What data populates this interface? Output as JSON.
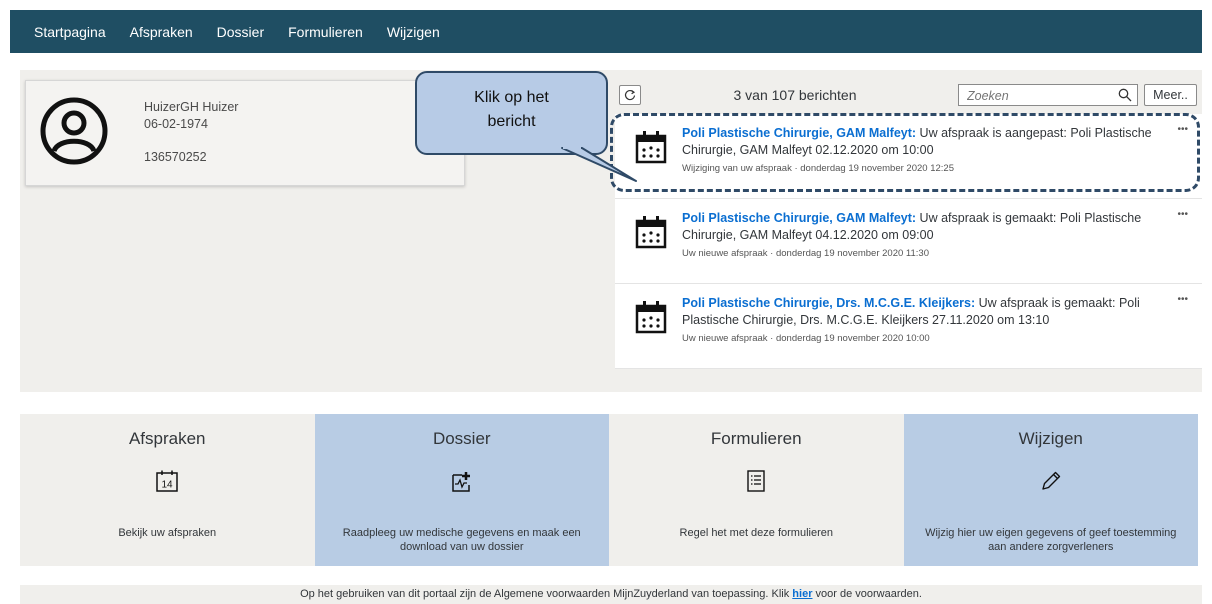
{
  "nav": {
    "items": [
      "Startpagina",
      "Afspraken",
      "Dossier",
      "Formulieren",
      "Wijzigen"
    ]
  },
  "profile": {
    "name": "HuizerGH Huizer",
    "dob": "06-02-1974",
    "id": "136570252"
  },
  "callout": {
    "line1": "Klik op het",
    "line2": "bericht"
  },
  "messages_toolbar": {
    "count_text": "3 van 107 berichten",
    "search_placeholder": "Zoeken",
    "more_label": "Meer.."
  },
  "messages": [
    {
      "title": "Poli Plastische Chirurgie, GAM Malfeyt:",
      "text": " Uw afspraak is aangepast: Poli Plastische Chirurgie, GAM Malfeyt 02.12.2020 om 10:00",
      "meta": "Wijziging van uw afspraak · donderdag 19 november 2020 12:25",
      "more": "•••"
    },
    {
      "title": "Poli Plastische Chirurgie, GAM Malfeyt:",
      "text": " Uw afspraak is gemaakt: Poli Plastische Chirurgie, GAM Malfeyt 04.12.2020 om 09:00",
      "meta": "Uw nieuwe afspraak · donderdag 19 november 2020 11:30",
      "more": "•••"
    },
    {
      "title": "Poli Plastische Chirurgie, Drs. M.C.G.E. Kleijkers:",
      "text": " Uw afspraak is gemaakt: Poli Plastische Chirurgie, Drs. M.C.G.E. Kleijkers 27.11.2020 om 13:10",
      "meta": "Uw nieuwe afspraak · donderdag 19 november 2020 10:00",
      "more": "•••"
    }
  ],
  "tiles": [
    {
      "title": "Afspraken",
      "icon": "calendar-14-icon",
      "icon_text": "14",
      "desc": "Bekijk uw afspraken"
    },
    {
      "title": "Dossier",
      "icon": "medical-record-icon",
      "desc": "Raadpleeg uw medische gegevens en maak een download van uw dossier"
    },
    {
      "title": "Formulieren",
      "icon": "form-list-icon",
      "desc": "Regel het met deze formulieren"
    },
    {
      "title": "Wijzigen",
      "icon": "pencil-icon",
      "desc": "Wijzig hier uw eigen gegevens of geef toestemming aan andere zorgverleners"
    }
  ],
  "footer": {
    "text_before": "Op het gebruiken van dit portaal zijn de Algemene voorwaarden MijnZuyderland van toepassing. Klik ",
    "link": "hier",
    "text_after": " voor de voorwaarden."
  },
  "colors": {
    "topbar": "#1f4e63",
    "link": "#0a6ed1",
    "tile_blue": "#b8cce4",
    "callout_fill": "#b7cbe6",
    "callout_border": "#2f4a67"
  }
}
